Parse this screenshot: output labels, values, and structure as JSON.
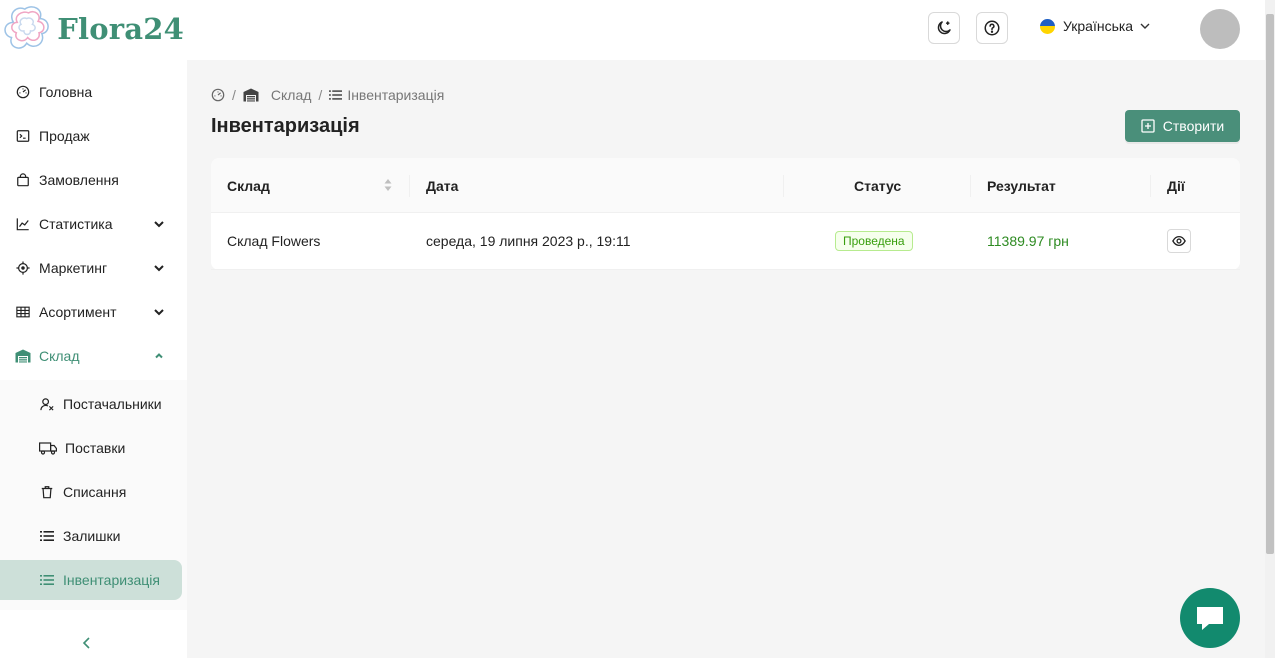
{
  "header": {
    "logo_text": "Flora24",
    "language": "Українська"
  },
  "sidebar": {
    "items": [
      {
        "label": "Головна",
        "icon": "dashboard-icon"
      },
      {
        "label": "Продаж",
        "icon": "terminal-icon"
      },
      {
        "label": "Замовлення",
        "icon": "shopping-bag-icon"
      },
      {
        "label": "Статистика",
        "icon": "line-chart-icon"
      },
      {
        "label": "Маркетинг",
        "icon": "aim-icon"
      },
      {
        "label": "Асортимент",
        "icon": "table-icon"
      },
      {
        "label": "Склад",
        "icon": "warehouse-icon"
      }
    ],
    "subitems": [
      {
        "label": "Постачальники",
        "icon": "suppliers-icon"
      },
      {
        "label": "Поставки",
        "icon": "truck-icon"
      },
      {
        "label": "Списання",
        "icon": "trash-icon"
      },
      {
        "label": "Залишки",
        "icon": "list-icon"
      },
      {
        "label": "Інвентаризація",
        "icon": "list-icon"
      }
    ]
  },
  "breadcrumb": {
    "warehouse": "Склад",
    "current": "Інвентаризація"
  },
  "page": {
    "title": "Інвентаризація",
    "create_label": "Створити"
  },
  "table": {
    "columns": [
      "Склад",
      "Дата",
      "Статус",
      "Результат",
      "Дії"
    ],
    "rows": [
      {
        "warehouse": "Склад Flowers",
        "date": "середа, 19 липня 2023 р., 19:11",
        "status": "Проведена",
        "result": "11389.97 грн"
      }
    ]
  },
  "colors": {
    "brand": "#3f8f75",
    "button": "#4a8f7a",
    "active_bg": "#cde0d9",
    "result_green": "#2e8b22",
    "chat": "#128a6e"
  }
}
